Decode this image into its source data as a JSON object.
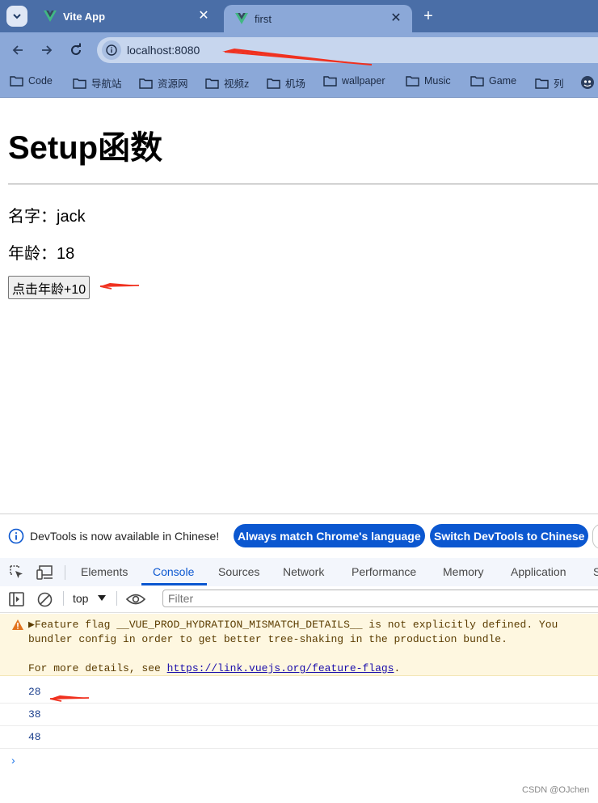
{
  "browser": {
    "tabs": [
      {
        "title": "Vite App",
        "active": false
      },
      {
        "title": "first",
        "active": true
      }
    ],
    "new_tab": "+",
    "close_glyph": "✕",
    "url": "localhost:8080",
    "bookmarks": [
      "Code",
      "导航站",
      "资源网",
      "视频z",
      "机场",
      "wallpaper",
      "Music",
      "Game",
      "列"
    ]
  },
  "page": {
    "title": "Setup函数",
    "name_line": "名字：jack",
    "age_line": "年龄：18",
    "button_label": "点击年龄+10"
  },
  "devtools": {
    "info_text": "DevTools is now available in Chinese!",
    "btn_match": "Always match Chrome's language",
    "btn_switch": "Switch DevTools to Chinese",
    "tabs": [
      "Elements",
      "Console",
      "Sources",
      "Network",
      "Performance",
      "Memory",
      "Application",
      "S"
    ],
    "active_tab": "Console",
    "context": "top",
    "filter_placeholder": "Filter",
    "warning": {
      "line1": "Feature flag __VUE_PROD_HYDRATION_MISMATCH_DETAILS__ is not explicitly defined. You",
      "line2": "bundler config in order to get better tree-shaking in the production bundle.",
      "line3_prefix": "For more details, see ",
      "link": "https://link.vuejs.org/feature-flags",
      "line3_suffix": "."
    },
    "logs": [
      "28",
      "38",
      "48"
    ],
    "prompt": "›"
  },
  "watermark": "CSDN @OJchen",
  "colors": {
    "tabbar": "#4a6ea7",
    "toolbar": "#8ba8d8",
    "accent": "#0b57d0",
    "annotation_arrow": "#f0311f"
  }
}
